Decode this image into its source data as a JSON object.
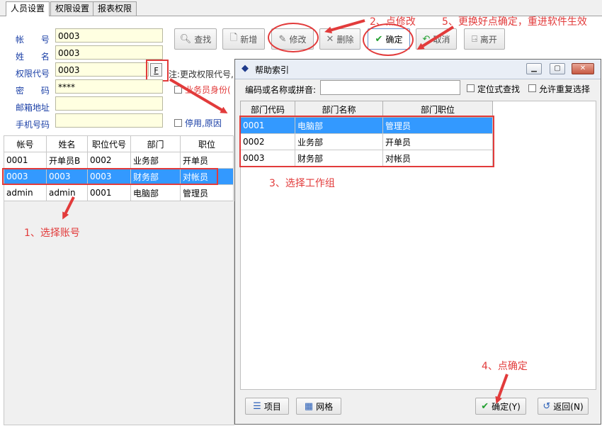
{
  "tabs": [
    "人员设置",
    "权限设置",
    "报表权限"
  ],
  "form": {
    "account_label": "帐 号",
    "account_value": "0003",
    "name_label": "姓 名",
    "name_value": "0003",
    "perm_code_label": "权限代号",
    "perm_code_value": "0003",
    "f_button": "F",
    "password_label": "密 码",
    "password_value": "****",
    "email_label": "邮箱地址",
    "email_value": "",
    "phone_label": "手机号码",
    "phone_value": "",
    "note_text": "注:更改权限代号,",
    "salesman_label": "业务员身份(",
    "disabled_label": "停用,原因"
  },
  "toolbar": {
    "find": "查找",
    "add": "新增",
    "modify": "修改",
    "delete": "删除",
    "ok": "确定",
    "cancel": "取消",
    "leave": "离开"
  },
  "user_grid": {
    "headers": [
      "帐号",
      "姓名",
      "职位代号",
      "部门",
      "职位"
    ],
    "rows": [
      [
        "0001",
        "开单员B",
        "0002",
        "业务部",
        "开单员"
      ],
      [
        "0003",
        "0003",
        "0003",
        "财务部",
        "对帐员"
      ],
      [
        "admin",
        "admin",
        "0001",
        "电脑部",
        "管理员"
      ]
    ]
  },
  "dialog": {
    "title": "帮助索引",
    "search_label": "编码或名称或拼音:",
    "search_value": "",
    "locate_label": "定位式查找",
    "allow_dup_label": "允许重复选择",
    "headers": [
      "部门代码",
      "部门名称",
      "部门职位"
    ],
    "rows": [
      [
        "0001",
        "电脑部",
        "管理员"
      ],
      [
        "0002",
        "业务部",
        "开单员"
      ],
      [
        "0003",
        "财务部",
        "对帐员"
      ]
    ],
    "item_button": "项目",
    "grid_button": "网格",
    "ok_button": "确定(Y)",
    "back_button": "返回(N)"
  },
  "annotations": {
    "step1": "1、选择账号",
    "step2": "2、点修改",
    "step3": "3、选择工作组",
    "step4": "4、点确定",
    "step5": "5、更换好点确定，重进软件生效"
  },
  "colors": {
    "annotation_red": "#e23b3b",
    "selection_blue": "#3399ff",
    "field_yellow": "#ffffe1",
    "label_blue": "#1a3fa6"
  }
}
